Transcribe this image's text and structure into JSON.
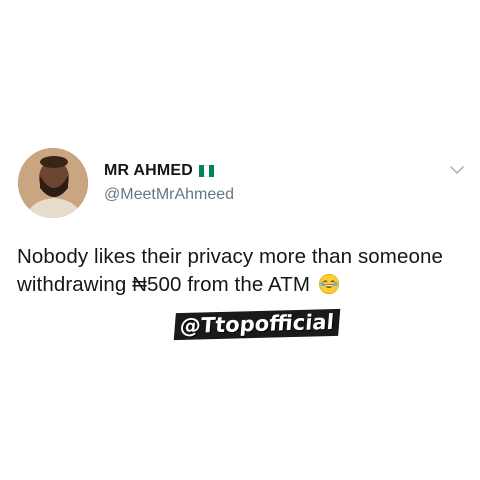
{
  "tweet": {
    "display_name": "MR AHMED",
    "flag_icon": "nigeria-flag-icon",
    "handle": "@MeetMrAhmeed",
    "text": "Nobody likes their privacy more than someone withdrawing ₦500 from the ATM",
    "emoji_icon": "face-with-tears-of-joy-icon",
    "menu_icon": "chevron-down-icon"
  },
  "watermark": {
    "text": "@Ttopofficial"
  },
  "colors": {
    "name": "#14171a",
    "handle": "#657786",
    "chevron": "#aab8c2",
    "flag_green": "#008751",
    "flag_white": "#ffffff"
  }
}
